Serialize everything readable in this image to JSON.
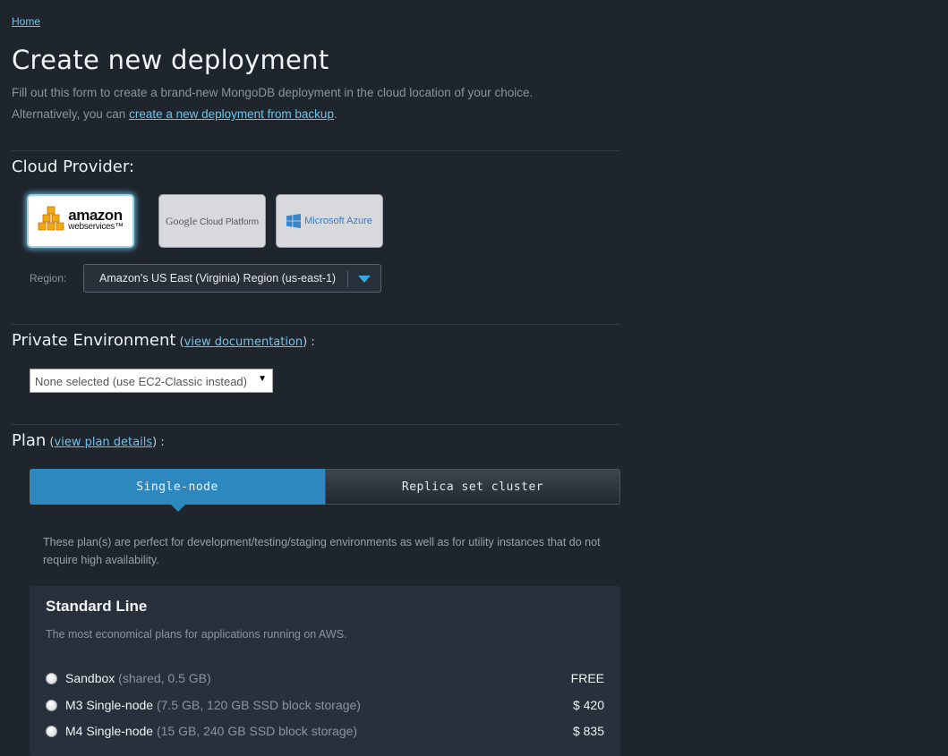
{
  "breadcrumb": {
    "home": "Home"
  },
  "page": {
    "title": "Create new deployment",
    "intro_line1": "Fill out this form to create a brand-new MongoDB deployment in the cloud location of your choice.",
    "intro_prefix": "Alternatively, you can ",
    "intro_link": "create a new deployment from backup",
    "intro_suffix": "."
  },
  "cloud_provider": {
    "title": "Cloud Provider:",
    "providers": [
      {
        "name": "Amazon Web Services",
        "logo_big": "amazon",
        "logo_small": "webservices",
        "tm": "™",
        "selected": true
      },
      {
        "name": "Google Cloud Platform",
        "logo_google": "Google",
        "logo_rest": "Cloud Platform",
        "selected": false
      },
      {
        "name": "Microsoft Azure",
        "logo_text": "Microsoft Azure",
        "selected": false
      }
    ],
    "region_label": "Region:",
    "region_value": "Amazon's US East (Virginia) Region (us-east-1)"
  },
  "private_env": {
    "title": "Private Environment",
    "open": " (",
    "link": "view documentation",
    "close": ") :",
    "select_value": "None selected (use EC2-Classic instead)",
    "arrow": "▼"
  },
  "plan": {
    "title": "Plan",
    "open": " (",
    "link": "view plan details",
    "close": ") :",
    "tabs": [
      "Single-node",
      "Replica set cluster"
    ],
    "description": "These plan(s) are perfect for development/testing/staging environments as well as for utility instances that do not require high availability.",
    "standard_line": {
      "title": "Standard Line",
      "subtitle": "The most economical plans for applications running on AWS.",
      "rows": [
        {
          "name": "Sandbox",
          "detail": "(shared, 0.5 GB)",
          "price": "FREE"
        },
        {
          "name": "M3 Single-node",
          "detail": "(7.5 GB, 120 GB SSD block storage)",
          "price": "$ 420"
        },
        {
          "name": "M4 Single-node",
          "detail": "(15 GB, 240 GB SSD block storage)",
          "price": "$ 835"
        }
      ]
    }
  },
  "colors": {
    "background": "#1e252d",
    "link": "#6fc3ea",
    "accent": "#2e88c0"
  }
}
